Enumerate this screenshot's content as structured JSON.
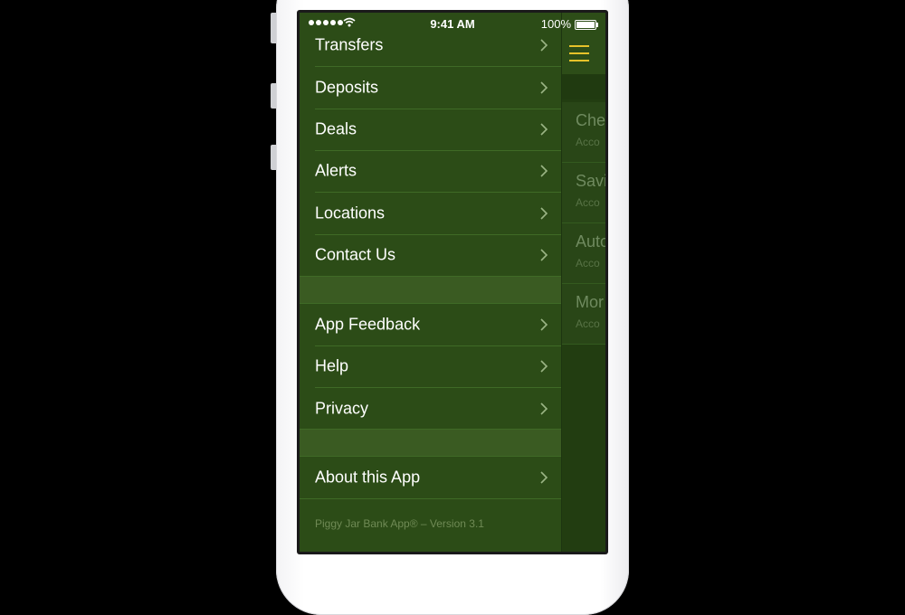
{
  "status_bar": {
    "time": "9:41 AM",
    "battery": "100%"
  },
  "menu": {
    "items": [
      {
        "label": "Transfers"
      },
      {
        "label": "Deposits"
      },
      {
        "label": "Deals"
      },
      {
        "label": "Alerts"
      },
      {
        "label": "Locations"
      },
      {
        "label": "Contact Us"
      },
      {
        "label": "App Feedback"
      },
      {
        "label": "Help"
      },
      {
        "label": "Privacy"
      },
      {
        "label": "About this App"
      }
    ],
    "footer": "Piggy Jar Bank App® – Version 3.1"
  },
  "content": {
    "accounts": [
      {
        "title": "Che",
        "subtitle": "Acco"
      },
      {
        "title": "Savi",
        "subtitle": "Acco"
      },
      {
        "title": "Auto",
        "subtitle": "Acco"
      },
      {
        "title": "Mor",
        "subtitle": "Acco"
      }
    ]
  },
  "colors": {
    "menu_bg": "#2c4c17",
    "accent": "#e6c22a"
  },
  "icons": [
    "chevron-right-icon",
    "hamburger-menu-icon",
    "wifi-icon",
    "battery-icon"
  ]
}
